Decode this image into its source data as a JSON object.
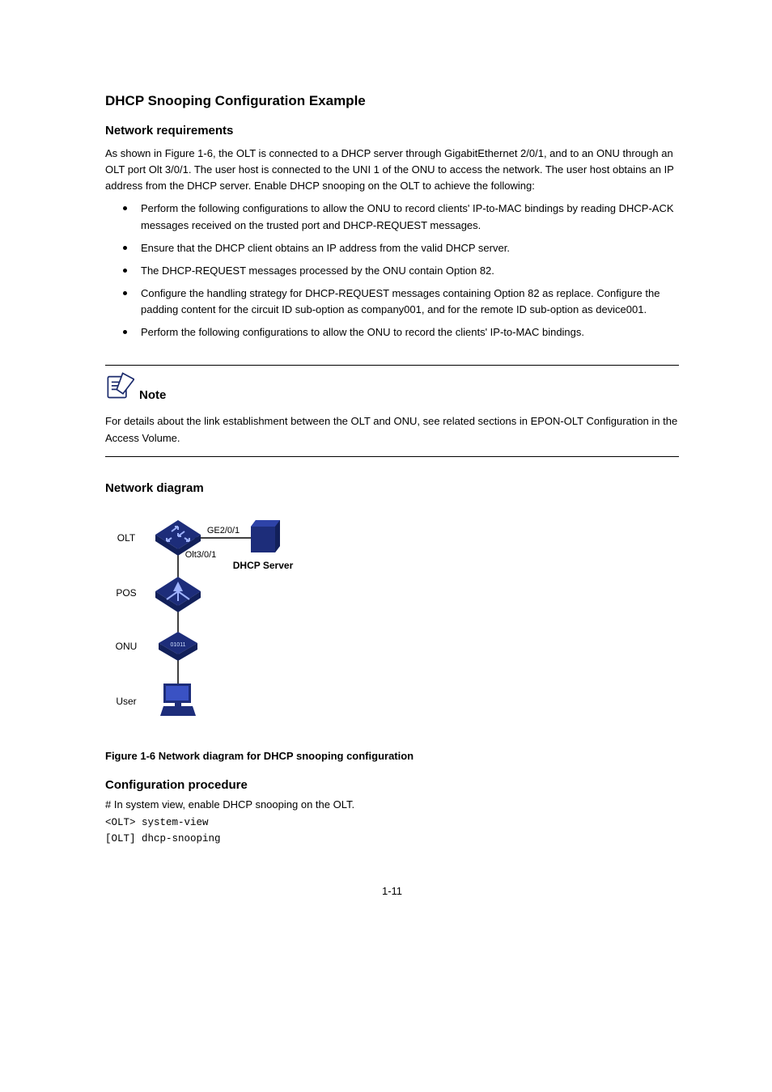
{
  "section_title": "DHCP Snooping Configuration Example",
  "nr_title": "Network requirements",
  "nr_intro": "As shown in Figure 1-6, the OLT is connected to a DHCP server through GigabitEthernet 2/0/1, and to an ONU through an OLT port Olt 3/0/1. The user host is connected to the UNI 1 of the ONU to access the network. The user host obtains an IP address from the DHCP server. Enable DHCP snooping on the OLT to achieve the following:",
  "bullets": [
    "Perform the following configurations to allow the ONU to record clients' IP-to-MAC bindings by reading DHCP-ACK messages received on the trusted port and DHCP-REQUEST messages.",
    "Ensure that the DHCP client obtains an IP address from the valid DHCP server.",
    "The DHCP-REQUEST messages processed by the ONU contain Option 82.",
    "Configure the handling strategy for DHCP-REQUEST messages containing Option 82 as replace. Configure the padding content for the circuit ID sub-option as company001, and for the remote ID sub-option as device001.",
    "Perform the following configurations to allow the ONU to record the clients' IP-to-MAC bindings."
  ],
  "note_label": "Note",
  "note_body": "For details about the link establishment between the OLT and ONU, see related sections in EPON-OLT Configuration in the Access Volume.",
  "diagram_title": "Network diagram",
  "diagram_labels": {
    "olt": "OLT",
    "pos": "POS",
    "onu": "ONU",
    "user": "User",
    "dhcp_server": "DHCP Server",
    "ge_port": "GE2/0/1",
    "olt_port": "Olt3/0/1"
  },
  "fig_caption": "Figure 1-6 Network diagram for DHCP snooping configuration",
  "config_title": "Configuration procedure",
  "config_step1": "# In system view, enable DHCP snooping on the OLT.",
  "cli": [
    "<OLT> system-view",
    "[OLT] dhcp-snooping"
  ],
  "page_number": "1-11"
}
